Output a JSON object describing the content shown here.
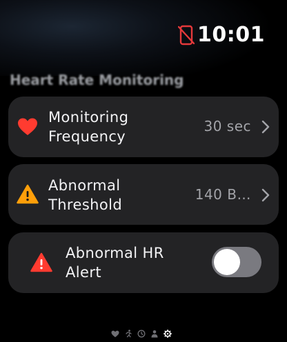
{
  "status": {
    "time": "10:01",
    "disconnected_icon": "phone-disconnected-icon",
    "disconnected_color": "#e5393b"
  },
  "section": {
    "title": "Heart Rate Monitoring"
  },
  "items": [
    {
      "label": "Monitoring\nFrequency",
      "value": "30 sec",
      "icon": "heart-icon",
      "icon_color": "#ff3b30",
      "has_chevron": true
    },
    {
      "label": "Abnormal\nThreshold",
      "value": "140 B…",
      "icon": "warning-triangle-icon",
      "icon_color": "#ff9f0a",
      "has_chevron": true
    },
    {
      "label": "Abnormal HR\nAlert",
      "icon": "alert-triangle-icon",
      "icon_color": "#ff3b30",
      "toggle_on": false
    }
  ],
  "page_indicator": {
    "icons": [
      "heart-page-icon",
      "running-page-icon",
      "clock-page-icon",
      "person-page-icon",
      "settings-page-icon"
    ],
    "active_index": 4
  }
}
